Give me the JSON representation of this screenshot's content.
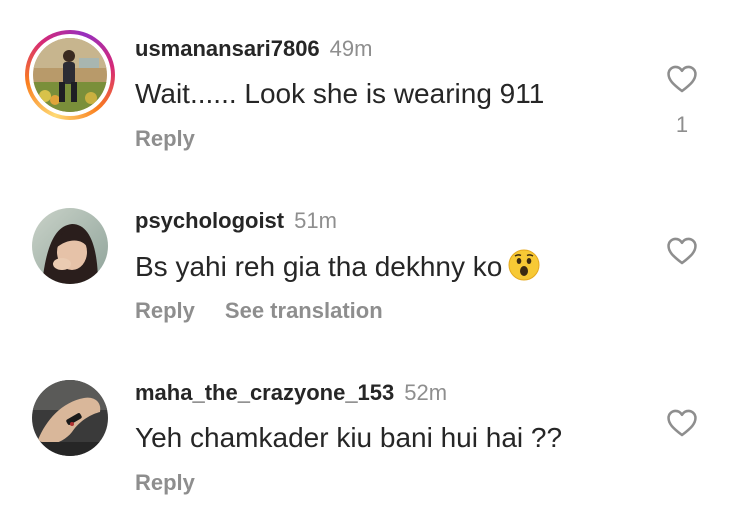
{
  "comments": [
    {
      "username": "usmanansari7806",
      "time": "49m",
      "text": "Wait...... Look she is wearing 911",
      "reply_label": "Reply",
      "like_count": "1",
      "has_story_ring": true
    },
    {
      "username": "psychologoist",
      "time": "51m",
      "text": "Bs yahi reh gia tha dekhny ko",
      "reply_label": "Reply",
      "see_translation_label": "See translation"
    },
    {
      "username": "maha_the_crazyone_153",
      "time": "52m",
      "text": "Yeh chamkader kiu bani hui hai ??",
      "reply_label": "Reply"
    }
  ],
  "icons": {
    "like": "heart-outline-icon",
    "emoji": "astonished-face-emoji"
  },
  "colors": {
    "text": "#262626",
    "secondary": "#8e8e8e",
    "ring_start": "#feda75",
    "ring_end": "#962fbf"
  }
}
